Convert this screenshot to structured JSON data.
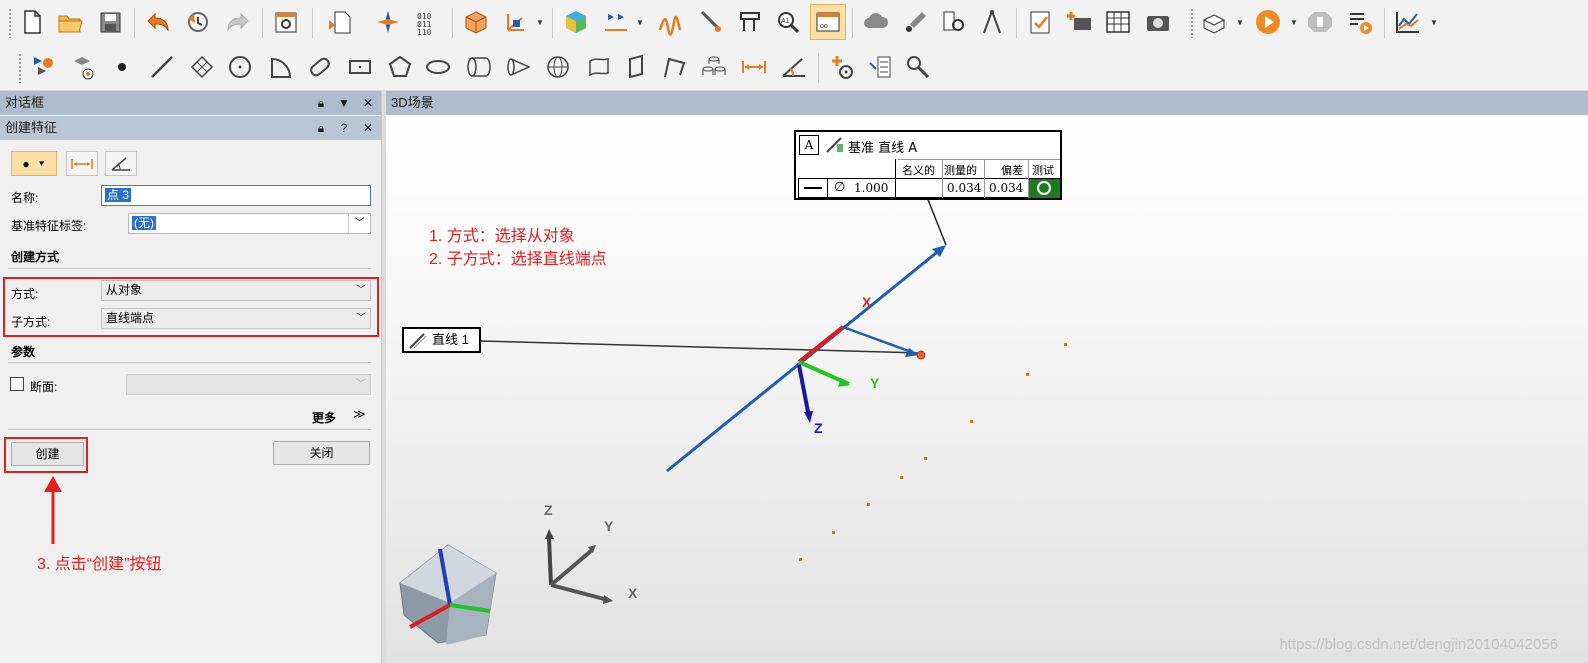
{
  "dialog_panel": {
    "title": "对话框",
    "subtitle": "创建特征",
    "name_label": "名称:",
    "name_value": "点 3",
    "datum_label": "基准特征标签:",
    "datum_value": "(无)",
    "section_method": "创建方式",
    "method_label": "方式:",
    "method_value": "从对象",
    "submethod_label": "子方式:",
    "submethod_value": "直线端点",
    "section_params": "参数",
    "section_label": "断面:",
    "more_label": "更多",
    "create_button": "创建",
    "close_button": "关闭"
  },
  "annotations": {
    "step1": "1. 方式：选择从对象",
    "step2": "2. 子方式：选择直线端点",
    "step3": "3. 点击“创建”按钮"
  },
  "scene": {
    "title": "3D场景",
    "fcf": {
      "datum": "A",
      "heading": "基准 直线 A",
      "col_nominal": "名义的",
      "col_measured": "测量的",
      "col_deviation": "偏差",
      "col_test": "测试",
      "diameter": "1.000",
      "measured": "0.034",
      "deviation": "0.034"
    },
    "line_label": "直线 1",
    "axis_x": "X",
    "axis_y": "Y",
    "axis_z": "Z",
    "watermark": "https://blog.csdn.net/dengjin20104042056"
  }
}
